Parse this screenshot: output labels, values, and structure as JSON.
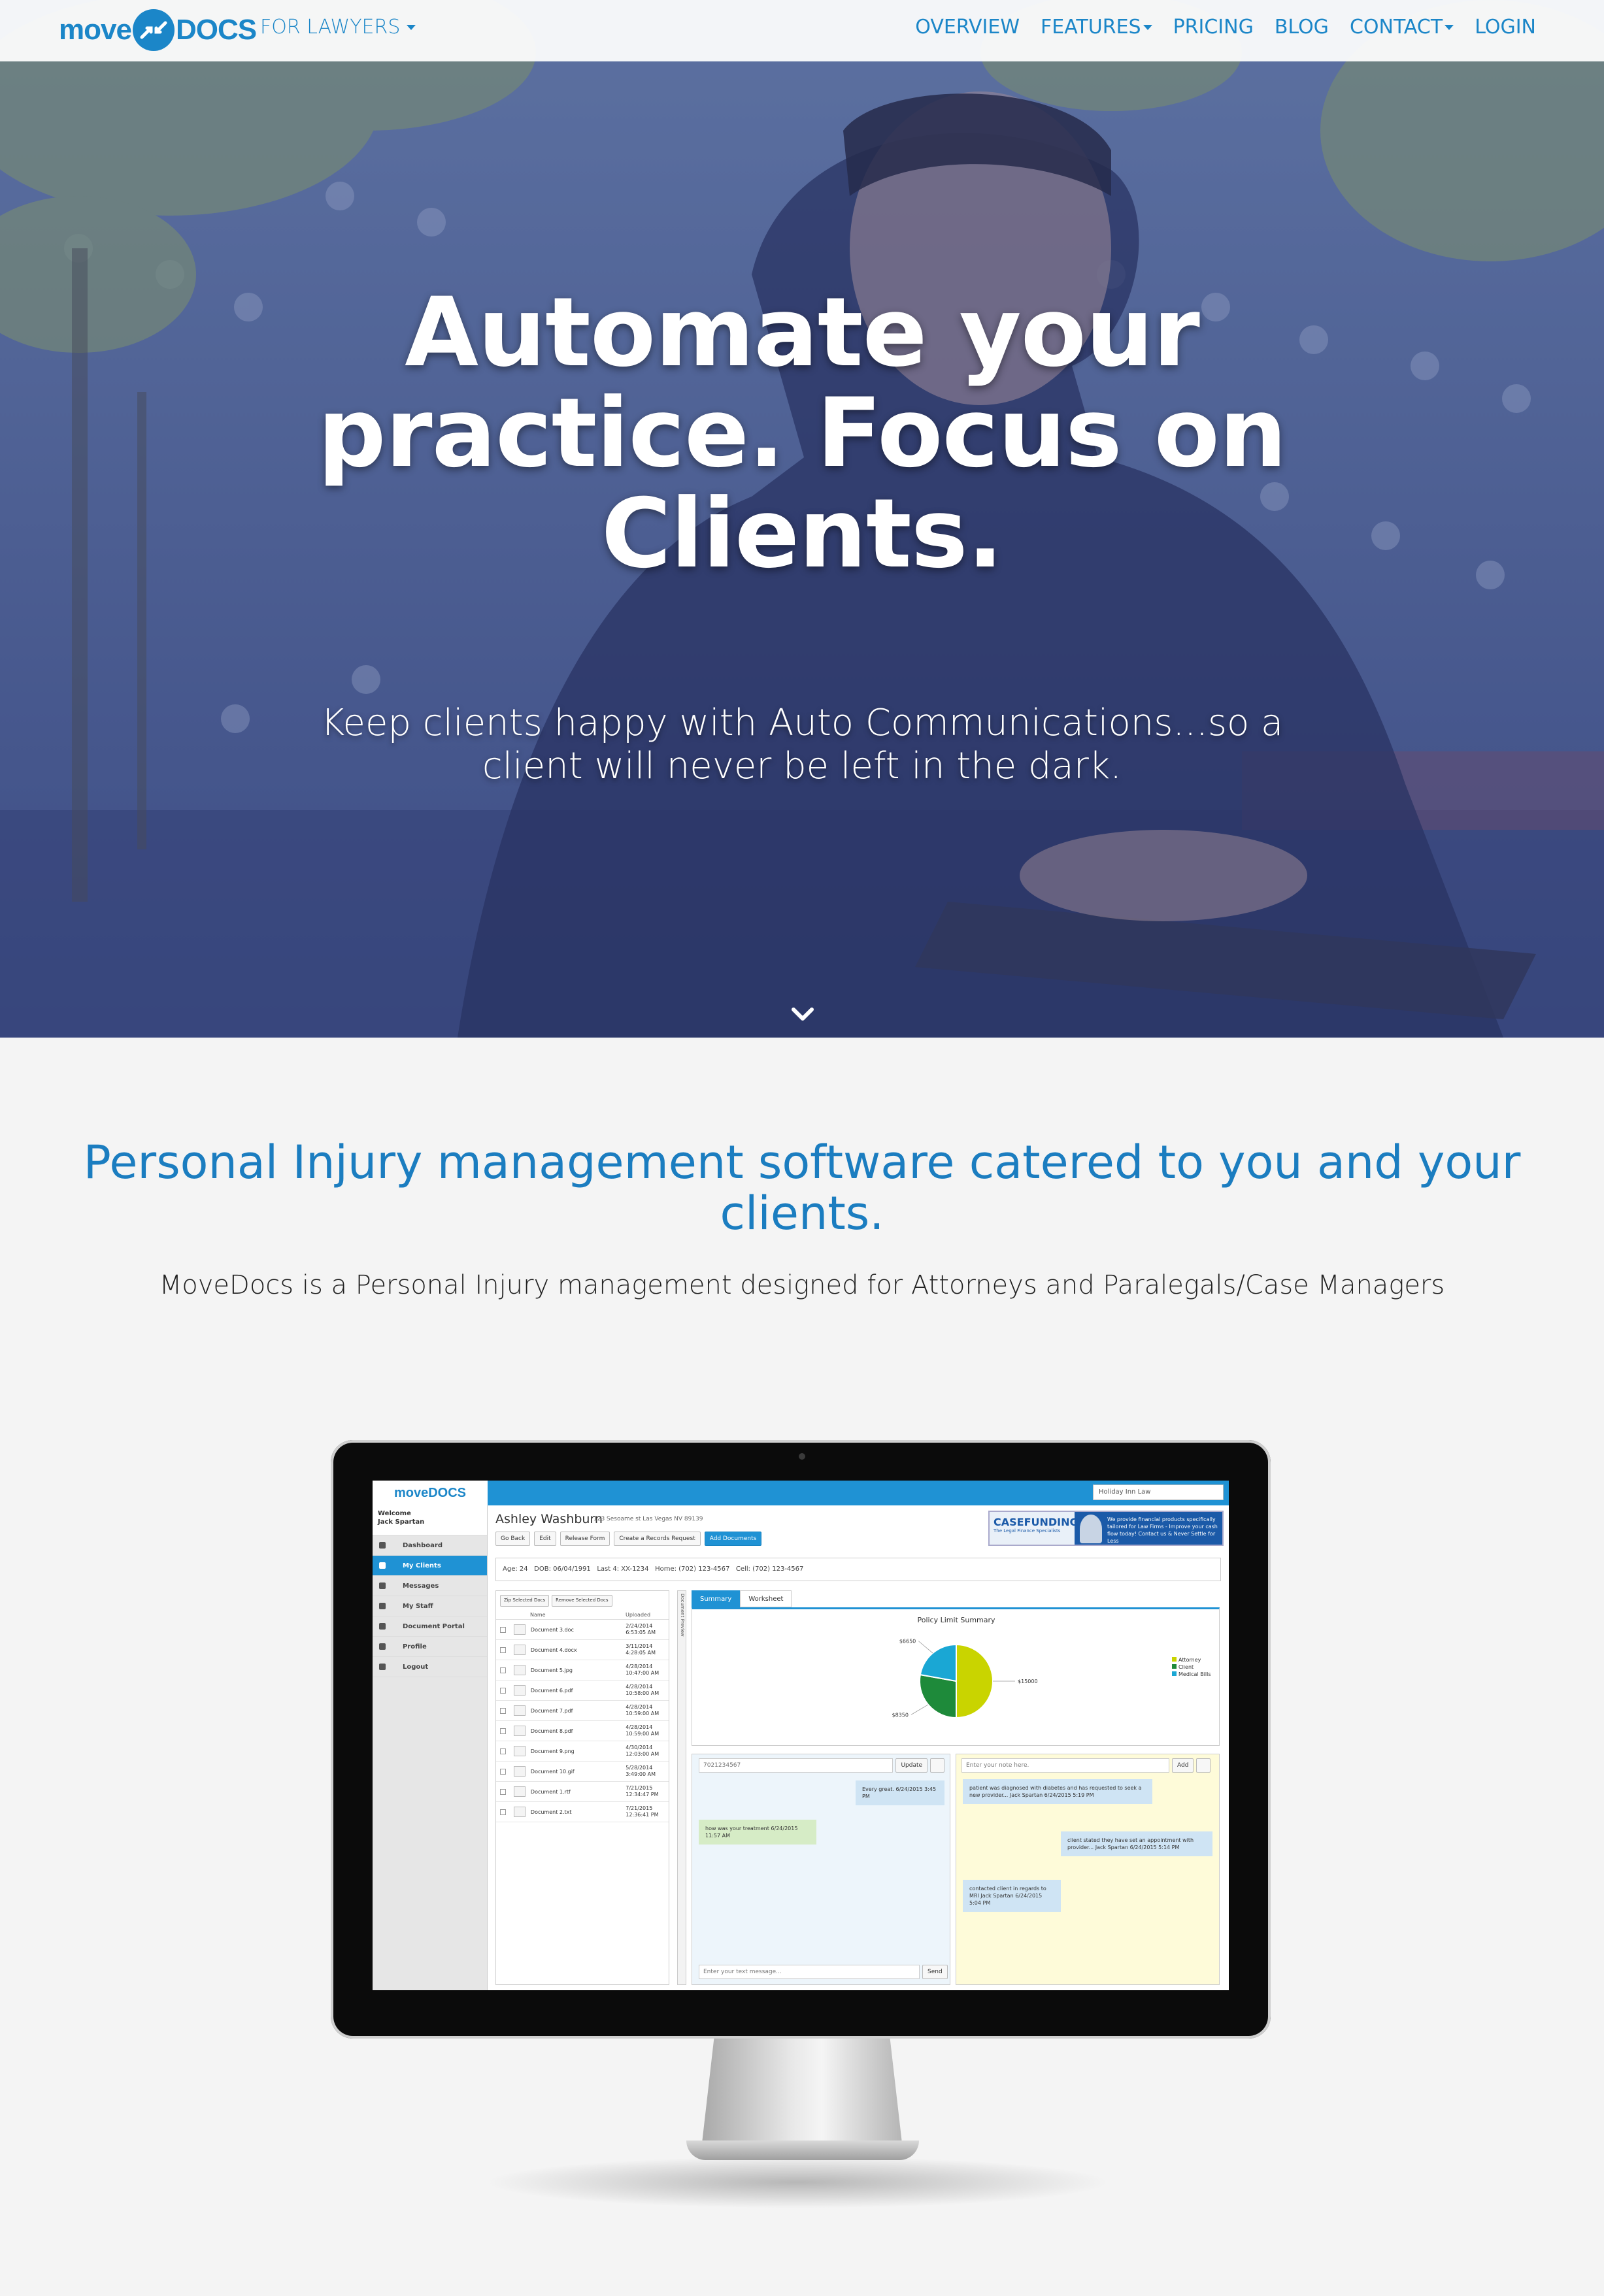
{
  "nav": {
    "logo_text_left": "move",
    "logo_text_right": "DOCS",
    "for_lawyers": "FOR LAWYERS",
    "items": [
      {
        "label": "OVERVIEW",
        "dropdown": false
      },
      {
        "label": "FEATURES",
        "dropdown": true
      },
      {
        "label": "PRICING",
        "dropdown": false
      },
      {
        "label": "BLOG",
        "dropdown": false
      },
      {
        "label": "CONTACT",
        "dropdown": true
      },
      {
        "label": "LOGIN",
        "dropdown": false
      }
    ]
  },
  "hero": {
    "title_line1": "Automate your",
    "title_line2": "practice. Focus on",
    "title_line3": "Clients.",
    "sub_line1": "Keep clients happy with Auto Communications...so a",
    "sub_line2": "client will never be left in the dark."
  },
  "section": {
    "title_line1": "Personal Injury management software catered to you and your",
    "title_line2": "clients.",
    "subtitle": "MoveDocs is a Personal Injury management designed for Attorneys and Paralegals/Case Managers"
  },
  "app": {
    "logo": "moveDOCS",
    "firm_select": "Holiday Inn Law",
    "welcome_line1": "Welcome",
    "welcome_line2": "Jack Spartan",
    "sidebar": [
      {
        "label": "Dashboard",
        "active": false
      },
      {
        "label": "My Clients",
        "active": true
      },
      {
        "label": "Messages",
        "active": false
      },
      {
        "label": "My Staff",
        "active": false
      },
      {
        "label": "Document Portal",
        "active": false
      },
      {
        "label": "Profile",
        "active": false
      },
      {
        "label": "Logout",
        "active": false
      }
    ],
    "client_name": "Ashley Washburn",
    "client_address": "123 Sesoame st Las Vegas NV 89139",
    "buttons": [
      "Go Back",
      "Edit",
      "Release Form",
      "Create a Records Request",
      "Add Documents"
    ],
    "ad": {
      "brand": "CASEFUNDING",
      "tagline": "The Legal Finance Specialists",
      "text": "We provide financial products specifically tailored for Law Firms - Improve your cash flow today! Contact us & Never Settle for Less"
    },
    "info": {
      "age": "Age: 24",
      "dob": "DOB: 06/04/1991",
      "last4": "Last 4: XX-1234",
      "home": "Home: (702) 123-4567",
      "cell": "Cell: (702) 123-4567"
    },
    "docs_buttons": [
      "Zip Selected Docs",
      "Remove Selected Docs"
    ],
    "docs_headers": [
      "Name",
      "Uploaded"
    ],
    "documents": [
      {
        "name": "Document 3.doc",
        "date": "2/24/2014 6:53:05 AM"
      },
      {
        "name": "Document 4.docx",
        "date": "3/11/2014 4:28:05 AM"
      },
      {
        "name": "Document 5.jpg",
        "date": "4/28/2014 10:47:00 AM"
      },
      {
        "name": "Document 6.pdf",
        "date": "4/28/2014 10:58:00 AM"
      },
      {
        "name": "Document 7.pdf",
        "date": "4/28/2014 10:59:00 AM"
      },
      {
        "name": "Document 8.pdf",
        "date": "4/28/2014 10:59:00 AM"
      },
      {
        "name": "Document 9.png",
        "date": "4/30/2014 12:03:00 AM"
      },
      {
        "name": "Document 10.gif",
        "date": "5/28/2014 3:49:00 AM"
      },
      {
        "name": "Document 1.rtf",
        "date": "7/21/2015 12:34:47 PM"
      },
      {
        "name": "Document 2.txt",
        "date": "7/21/2015 12:36:41 PM"
      }
    ],
    "doc_preview_label": "Document Preview",
    "tabs": [
      "Summary",
      "Worksheet"
    ],
    "chat": {
      "phone": "7021234567",
      "update": "Update",
      "bubble_right": "Every great. 6/24/2015 3:45 PM",
      "bubble_left": "how was your treatment 6/24/2015 11:57 AM",
      "placeholder": "Enter your text message...",
      "send": "Send"
    },
    "notes": {
      "placeholder": "Enter your note here.",
      "add": "Add",
      "note1": "patient was diagnosed with diabetes and has requested to seek a new provider... Jack Spartan 6/24/2015 5:19 PM",
      "note2": "client stated they have set an appointment with provider... Jack Spartan 6/24/2015 5:14 PM",
      "note3": "contacted client in regards to MRI Jack Spartan 6/24/2015 5:04 PM"
    }
  },
  "chart_data": {
    "type": "pie",
    "title": "Policy Limit Summary",
    "categories": [
      "Attorney",
      "Client",
      "Medical Bills"
    ],
    "values": [
      15000,
      8350,
      6650
    ],
    "labels": [
      "$15000",
      "$8350",
      "$6650"
    ],
    "colors": [
      "#c9d400",
      "#1e8a3a",
      "#1aa7d4"
    ],
    "legend": "right"
  },
  "colors": {
    "brand_blue": "#1b86c8",
    "app_blue": "#1f92d4"
  }
}
